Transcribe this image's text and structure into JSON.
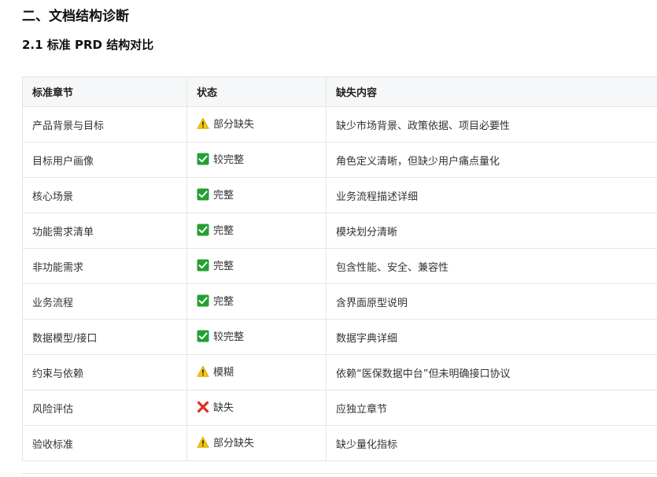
{
  "headings": {
    "section": "二、文档结构诊断",
    "subsection": "2.1 标准 PRD 结构对比"
  },
  "table": {
    "headers": [
      "标准章节",
      "状态",
      "缺失内容"
    ],
    "rows": [
      {
        "chapter": "产品背景与目标",
        "status_icon": "warning-icon",
        "status": "部分缺失",
        "missing": "缺少市场背景、政策依据、项目必要性"
      },
      {
        "chapter": "目标用户画像",
        "status_icon": "check-icon",
        "status": "较完整",
        "missing": "角色定义清晰，但缺少用户痛点量化"
      },
      {
        "chapter": "核心场景",
        "status_icon": "check-icon",
        "status": "完整",
        "missing": "业务流程描述详细"
      },
      {
        "chapter": "功能需求清单",
        "status_icon": "check-icon",
        "status": "完整",
        "missing": "模块划分清晰"
      },
      {
        "chapter": "非功能需求",
        "status_icon": "check-icon",
        "status": "完整",
        "missing": "包含性能、安全、兼容性"
      },
      {
        "chapter": "业务流程",
        "status_icon": "check-icon",
        "status": "完整",
        "missing": "含界面原型说明"
      },
      {
        "chapter": "数据模型/接口",
        "status_icon": "check-icon",
        "status": "较完整",
        "missing": "数据字典详细"
      },
      {
        "chapter": "约束与依赖",
        "status_icon": "warning-icon",
        "status": "模糊",
        "missing": "依赖“医保数据中台”但未明确接口协议"
      },
      {
        "chapter": "风险评估",
        "status_icon": "cross-icon",
        "status": "缺失",
        "missing": "应独立章节"
      },
      {
        "chapter": "验收标准",
        "status_icon": "warning-icon",
        "status": "部分缺失",
        "missing": "缺少量化指标"
      }
    ]
  },
  "colors": {
    "check": "#22a033",
    "warning": "#f5c400",
    "cross": "#d93025"
  }
}
